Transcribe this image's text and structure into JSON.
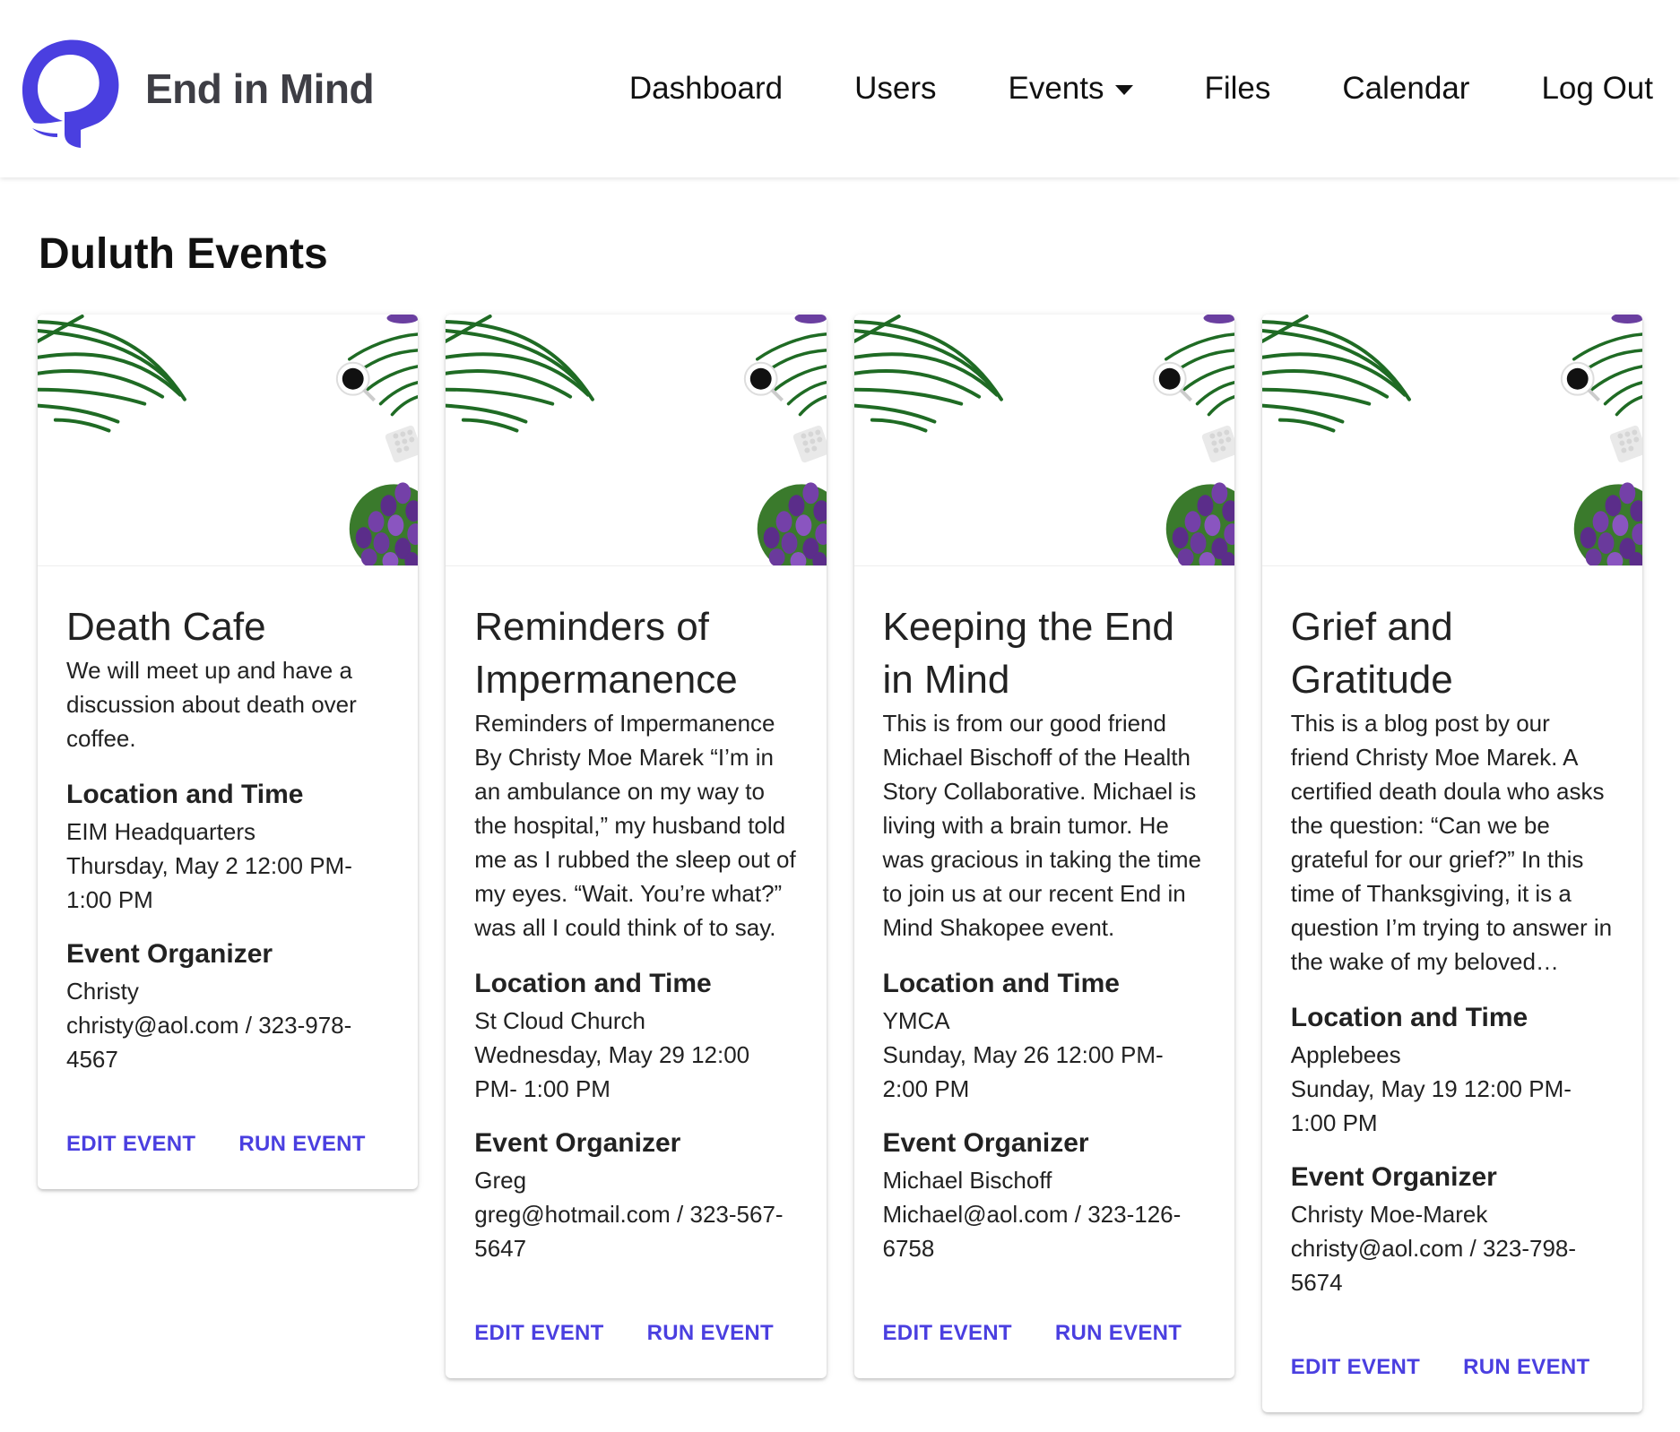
{
  "brand": {
    "name": "End in Mind",
    "accent": "#4a3fe0"
  },
  "nav": {
    "dashboard": "Dashboard",
    "users": "Users",
    "events": "Events",
    "files": "Files",
    "calendar": "Calendar",
    "logout": "Log Out"
  },
  "page": {
    "title": "Duluth Events"
  },
  "labels": {
    "location_time": "Location and Time",
    "organizer": "Event Organizer",
    "edit": "EDIT EVENT",
    "run": "RUN EVENT"
  },
  "events": [
    {
      "title": "Death Cafe",
      "description": "We will meet up and have a discussion about death over coffee.",
      "location": "EIM Headquarters",
      "time": "Thursday, May 2 12:00 PM- 1:00 PM",
      "organizer_name": "Christy",
      "organizer_contact": "christy@aol.com / 323-978-4567"
    },
    {
      "title": "Reminders of Impermanence",
      "description": "Reminders of Impermanence By Christy Moe Marek “I’m in an ambulance on my way to the hospital,” my husband told me as I rubbed the sleep out of my eyes. “Wait. You’re what?” was all I could think of to say.",
      "location": "St Cloud Church",
      "time": "Wednesday, May 29 12:00 PM- 1:00 PM",
      "organizer_name": "Greg",
      "organizer_contact": "greg@hotmail.com / 323-567-5647"
    },
    {
      "title": "Keeping the End in Mind",
      "description": "This is from our good friend Michael Bischoff of the Health Story Collaborative. Michael is living with a brain tumor. He was gracious in taking the time to join us at our recent End in Mind Shakopee event.",
      "location": "YMCA",
      "time": "Sunday, May 26 12:00 PM- 2:00 PM",
      "organizer_name": "Michael Bischoff",
      "organizer_contact": "Michael@aol.com / 323-126-6758"
    },
    {
      "title": "Grief and Gratitude",
      "description": "This is a blog post by our friend Christy Moe Marek. A certified death doula who asks the question: “Can we be grateful for our grief?” In this time of Thanksgiving, it is a question I’m trying to answer in the wake of my beloved…",
      "location": "Applebees",
      "time": "Sunday, May 19 12:00 PM- 1:00 PM",
      "organizer_name": "Christy Moe-Marek",
      "organizer_contact": "christy@aol.com / 323-798-5674"
    }
  ]
}
